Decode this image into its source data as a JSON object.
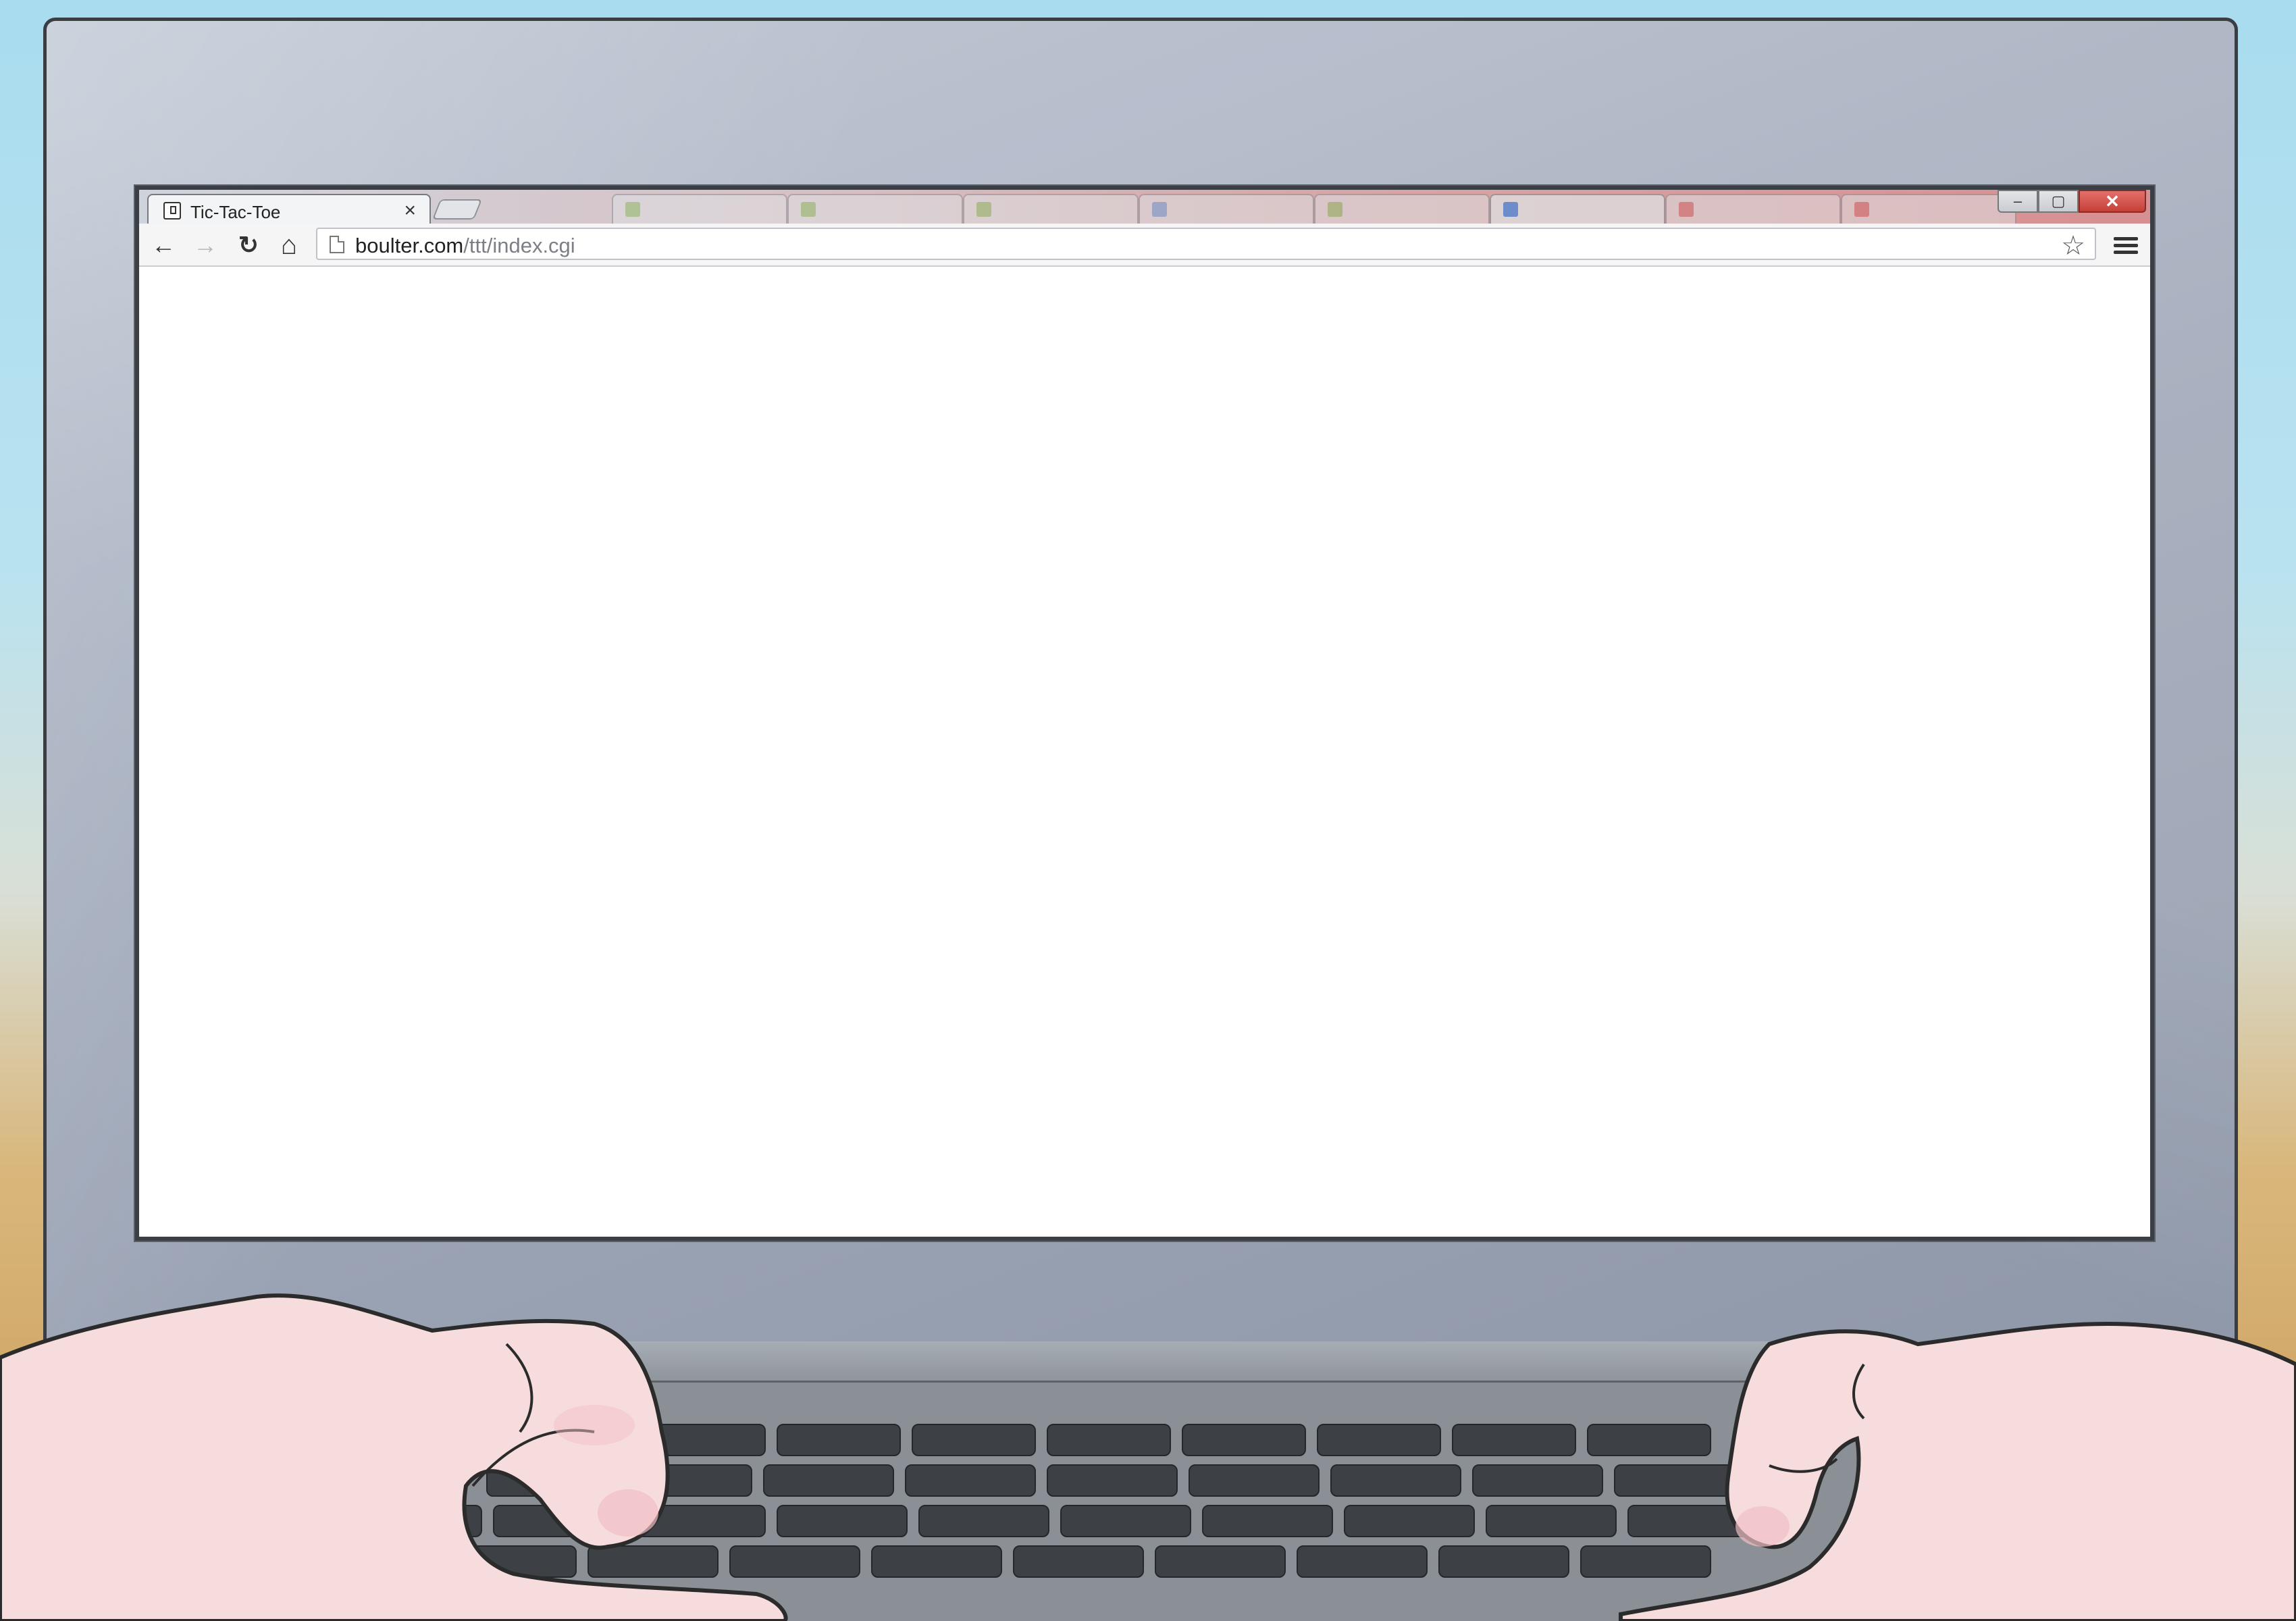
{
  "browser": {
    "active_tab": {
      "title": "Tic-Tac-Toe",
      "close_glyph": "×",
      "favicon": "page-icon"
    },
    "new_tab_button": "new-tab-icon",
    "window_controls": {
      "minimize": "–",
      "maximize": "▢",
      "close": "✕"
    },
    "toolbar": {
      "back_icon": "←",
      "forward_icon": "→",
      "reload_icon": "↻",
      "home_icon": "⌂",
      "star_icon": "☆"
    },
    "address_bar": {
      "url_host": "boulter.com",
      "url_path": "/ttt/index.cgi"
    },
    "page_content": ""
  },
  "colors": {
    "tab_strip_accent": "#d78f91",
    "close_button": "#c6403a",
    "screen_background": "#ffffff"
  }
}
